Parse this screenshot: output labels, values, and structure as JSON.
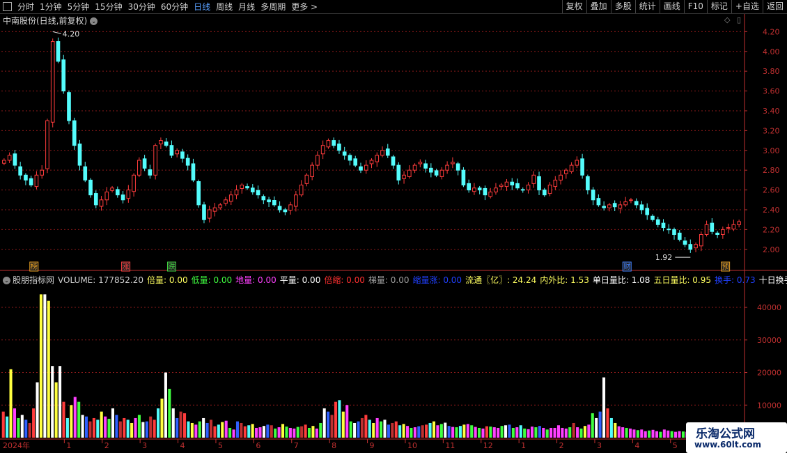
{
  "toolbar": {
    "left": [
      {
        "label": "分时",
        "active": false
      },
      {
        "label": "1分钟",
        "active": false
      },
      {
        "label": "5分钟",
        "active": false
      },
      {
        "label": "15分钟",
        "active": false
      },
      {
        "label": "30分钟",
        "active": false
      },
      {
        "label": "60分钟",
        "active": false
      },
      {
        "label": "日线",
        "active": true
      },
      {
        "label": "周线",
        "active": false
      },
      {
        "label": "月线",
        "active": false
      },
      {
        "label": "多周期",
        "active": false
      },
      {
        "label": "更多 >",
        "active": false
      }
    ],
    "right": [
      "复权",
      "叠加",
      "多股",
      "统计",
      "画线",
      "F10",
      "标记",
      "+自选",
      "返回"
    ]
  },
  "price_panel": {
    "title": "中南股份(日线,前复权)",
    "high_label": "4.20",
    "low_label": "1.92",
    "event_markers": [
      {
        "text": "榜",
        "color": "#e8a020"
      },
      {
        "text": "涨",
        "color": "#ff4040"
      },
      {
        "text": "跌",
        "color": "#40d040"
      },
      {
        "text": "财",
        "color": "#4080ff"
      },
      {
        "text": "预",
        "color": "#e8a020"
      }
    ]
  },
  "indicator_panel": {
    "items": [
      {
        "text": "股朋指标网",
        "color": "#d0d0d0"
      },
      {
        "text": "VOLUME: 177852.20",
        "color": "#d0d0d0"
      },
      {
        "text": "倍量: 0.00",
        "color": "#ffff60"
      },
      {
        "text": "低量: 0.00",
        "color": "#40ff40"
      },
      {
        "text": "地量: 0.00",
        "color": "#ff40ff"
      },
      {
        "text": "平量: 0.00",
        "color": "#ffffff"
      },
      {
        "text": "倍缩: 0.00",
        "color": "#ff3030"
      },
      {
        "text": "梯量: 0.00",
        "color": "#a0a0a0"
      },
      {
        "text": "缩量涨: 0.00",
        "color": "#2040ff"
      },
      {
        "text": "流通〖亿〗: 24.24",
        "color": "#ffff60"
      },
      {
        "text": "内外比: 1.53",
        "color": "#ffff60"
      },
      {
        "text": "单日量比: 1.08",
        "color": "#ffffff"
      },
      {
        "text": "五日量比: 0.95",
        "color": "#ffff60"
      },
      {
        "text": "换手: 0.73",
        "color": "#2040ff"
      },
      {
        "text": "十日换手",
        "color": "#ffffff"
      }
    ]
  },
  "x_axis": {
    "year_label": "2024年",
    "month_labels": [
      "1",
      "2",
      "3",
      "4",
      "5",
      "6",
      "7",
      "8",
      "9",
      "10",
      "11",
      "12",
      "1",
      "2",
      "3",
      "4",
      "5",
      "6"
    ]
  },
  "watermark": {
    "line1": "乐淘公式网",
    "line2": "www.60lt.com"
  },
  "colors": {
    "up": "#ff3c3c",
    "down": "#54fcfc",
    "grid": "#8b1a1a",
    "axis": "#c03030",
    "text": "#c8c8c8"
  },
  "chart_data": [
    {
      "type": "line",
      "title": "中南股份(日线,前复权)",
      "y_ticks": [
        4.2,
        4.0,
        3.8,
        3.6,
        3.4,
        3.2,
        3.0,
        2.8,
        2.6,
        2.4,
        2.2,
        2.0
      ],
      "ylim": [
        1.9,
        4.28
      ],
      "series": [
        {
          "name": "close",
          "values": [
            2.9,
            2.95,
            2.85,
            2.75,
            2.7,
            2.65,
            2.75,
            2.8,
            3.3,
            4.1,
            3.9,
            3.6,
            3.3,
            3.05,
            2.85,
            2.7,
            2.55,
            2.45,
            2.5,
            2.58,
            2.62,
            2.55,
            2.5,
            2.6,
            2.75,
            2.9,
            2.82,
            2.75,
            3.05,
            3.1,
            3.05,
            2.95,
            3.0,
            2.92,
            2.85,
            2.7,
            2.45,
            2.3,
            2.4,
            2.42,
            2.45,
            2.5,
            2.55,
            2.6,
            2.65,
            2.62,
            2.58,
            2.55,
            2.5,
            2.48,
            2.45,
            2.4,
            2.38,
            2.45,
            2.55,
            2.65,
            2.75,
            2.85,
            2.95,
            3.05,
            3.1,
            3.05,
            3.0,
            2.95,
            2.9,
            2.85,
            2.8,
            2.85,
            2.9,
            2.95,
            3.0,
            2.95,
            2.85,
            2.7,
            2.75,
            2.8,
            2.85,
            2.88,
            2.82,
            2.78,
            2.75,
            2.8,
            2.85,
            2.88,
            2.8,
            2.65,
            2.6,
            2.62,
            2.6,
            2.55,
            2.58,
            2.62,
            2.65,
            2.68,
            2.65,
            2.62,
            2.6,
            2.65,
            2.75,
            2.6,
            2.55,
            2.65,
            2.7,
            2.75,
            2.8,
            2.85,
            2.9,
            2.75,
            2.6,
            2.5,
            2.45,
            2.42,
            2.45,
            2.43,
            2.45,
            2.48,
            2.5,
            2.45,
            2.4,
            2.35,
            2.3,
            2.25,
            2.22,
            2.2,
            2.15,
            2.1,
            2.05,
            2.0,
            2.05,
            2.15,
            2.25,
            2.18,
            2.15,
            2.2,
            2.22,
            2.25,
            2.28
          ]
        }
      ],
      "annotations": [
        {
          "text": "4.20",
          "value": 4.2
        },
        {
          "text": "1.92",
          "value": 1.92
        }
      ]
    },
    {
      "type": "bar",
      "title": "VOLUME",
      "y_ticks": [
        40000,
        30000,
        20000,
        10000
      ],
      "ylim": [
        0,
        47500
      ],
      "values": [
        8000,
        6500,
        21000,
        9000,
        6000,
        7000,
        5500,
        4500,
        9000,
        17000,
        44000,
        44000,
        42000,
        22000,
        17000,
        22000,
        11000,
        6000,
        10000,
        12500,
        11000,
        7000,
        6500,
        5000,
        6000,
        5500,
        8000,
        6500,
        5800,
        9000,
        7000,
        5000,
        6000,
        5500,
        4500,
        6000,
        7000,
        4800,
        5000,
        6500,
        5500,
        9000,
        12000,
        20000,
        15000,
        9000,
        6000,
        8000,
        7500,
        5000,
        4500,
        4000,
        5000,
        6000,
        4500,
        5500,
        3500,
        4000,
        4800,
        5200,
        3000,
        2500,
        5000,
        4500,
        3500,
        3800,
        4200,
        3000,
        3200,
        3600,
        4000,
        3800,
        2800,
        3200,
        4200,
        3400,
        3000,
        2800,
        3300,
        3500,
        4000,
        3000,
        3600,
        2800,
        4500,
        9000,
        8000,
        7000,
        11000,
        11500,
        8000,
        10000,
        5000,
        4500,
        5000,
        6000,
        7000,
        5500,
        4500,
        6000,
        5000,
        5500,
        4000,
        4500,
        5000,
        3800,
        4200,
        3600,
        3000,
        3200,
        3500,
        3800,
        4000,
        4500,
        5000,
        3800,
        4200,
        4600,
        3600,
        3300,
        3200,
        3600,
        4000,
        4200,
        3800,
        3300,
        3000,
        2800,
        3500,
        3400,
        3200,
        3000,
        3600,
        3800,
        4000,
        3000,
        3200,
        3800,
        2800,
        2600,
        3400,
        3200,
        3600,
        3000,
        2500,
        3000,
        3000,
        3800,
        3000,
        2800,
        3200,
        4500,
        3200,
        2800,
        3600,
        4000,
        7500,
        6000,
        8000,
        18500,
        9000,
        6000,
        4500,
        3500,
        3200,
        3000,
        2800,
        2500,
        2300,
        2500,
        2000,
        2200,
        2400,
        2000,
        1800,
        2500,
        2200,
        2000,
        1800,
        2000,
        1900,
        1800,
        1600,
        1800,
        2000,
        1800,
        1600,
        1900,
        1700,
        1800,
        1600,
        1500,
        1700,
        1800,
        1600,
        2000
      ]
    }
  ]
}
